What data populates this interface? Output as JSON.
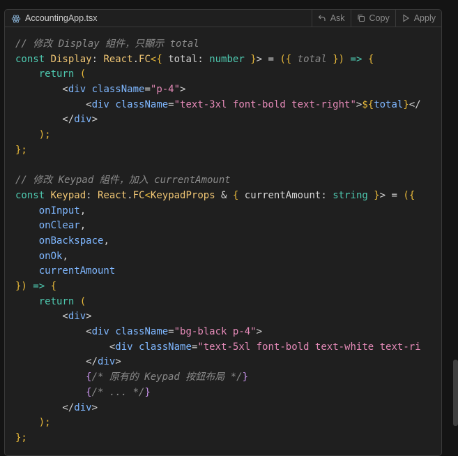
{
  "header": {
    "filename": "AccountingApp.tsx",
    "file_icon": "react-icon",
    "actions": [
      {
        "label": "Ask",
        "icon": "reply-icon"
      },
      {
        "label": "Copy",
        "icon": "copy-icon"
      },
      {
        "label": "Apply",
        "icon": "play-icon"
      }
    ]
  },
  "code_lines": [
    [
      {
        "t": "// 修改 Display 組件，只顯示 total",
        "c": "comment"
      }
    ],
    [
      {
        "t": "const ",
        "c": "kw"
      },
      {
        "t": "Display",
        "c": "fn"
      },
      {
        "t": ": ",
        "c": ""
      },
      {
        "t": "React",
        "c": "ty"
      },
      {
        "t": ".",
        "c": ""
      },
      {
        "t": "FC",
        "c": "ty"
      },
      {
        "t": "<{",
        "c": "br"
      },
      {
        "t": " total",
        "c": ""
      },
      {
        "t": ": ",
        "c": ""
      },
      {
        "t": "number",
        "c": "kw"
      },
      {
        "t": " }",
        "c": "br"
      },
      {
        "t": "> = ",
        "c": ""
      },
      {
        "t": "({ ",
        "c": "br"
      },
      {
        "t": "total",
        "c": "comment"
      },
      {
        "t": " })",
        "c": "br"
      },
      {
        "t": " => ",
        "c": "kw"
      },
      {
        "t": "{",
        "c": "br"
      }
    ],
    [
      {
        "t": "    return ",
        "c": "kw"
      },
      {
        "t": "(",
        "c": "br"
      }
    ],
    [
      {
        "t": "        <",
        "c": ""
      },
      {
        "t": "div",
        "c": "prop"
      },
      {
        "t": " ",
        "c": ""
      },
      {
        "t": "className",
        "c": "prop"
      },
      {
        "t": "=",
        "c": ""
      },
      {
        "t": "\"p-4\"",
        "c": "str"
      },
      {
        "t": ">",
        "c": ""
      }
    ],
    [
      {
        "t": "            <",
        "c": ""
      },
      {
        "t": "div",
        "c": "prop"
      },
      {
        "t": " ",
        "c": ""
      },
      {
        "t": "className",
        "c": "prop"
      },
      {
        "t": "=",
        "c": ""
      },
      {
        "t": "\"text-3xl font-bold text-right\"",
        "c": "str"
      },
      {
        "t": ">",
        "c": ""
      },
      {
        "t": "${",
        "c": "br"
      },
      {
        "t": "total",
        "c": "prop"
      },
      {
        "t": "}",
        "c": "br"
      },
      {
        "t": "</",
        "c": ""
      }
    ],
    [
      {
        "t": "        </",
        "c": ""
      },
      {
        "t": "div",
        "c": "prop"
      },
      {
        "t": ">",
        "c": ""
      }
    ],
    [
      {
        "t": "    );",
        "c": "br"
      }
    ],
    [
      {
        "t": "};",
        "c": "br"
      }
    ],
    [
      {
        "t": "",
        "c": ""
      }
    ],
    [
      {
        "t": "// 修改 Keypad 組件，加入 currentAmount",
        "c": "comment"
      }
    ],
    [
      {
        "t": "const ",
        "c": "kw"
      },
      {
        "t": "Keypad",
        "c": "fn"
      },
      {
        "t": ": ",
        "c": ""
      },
      {
        "t": "React",
        "c": "ty"
      },
      {
        "t": ".",
        "c": ""
      },
      {
        "t": "FC",
        "c": "ty"
      },
      {
        "t": "<",
        "c": "br"
      },
      {
        "t": "KeypadProps",
        "c": "ty"
      },
      {
        "t": " & ",
        "c": ""
      },
      {
        "t": "{",
        "c": "br"
      },
      {
        "t": " currentAmount",
        "c": ""
      },
      {
        "t": ": ",
        "c": ""
      },
      {
        "t": "string",
        "c": "kw"
      },
      {
        "t": " }",
        "c": "br"
      },
      {
        "t": "> = ",
        "c": ""
      },
      {
        "t": "({",
        "c": "br"
      }
    ],
    [
      {
        "t": "    onInput",
        "c": "prop"
      },
      {
        "t": ",",
        "c": ""
      }
    ],
    [
      {
        "t": "    onClear",
        "c": "prop"
      },
      {
        "t": ",",
        "c": ""
      }
    ],
    [
      {
        "t": "    onBackspace",
        "c": "prop"
      },
      {
        "t": ",",
        "c": ""
      }
    ],
    [
      {
        "t": "    onOk",
        "c": "prop"
      },
      {
        "t": ",",
        "c": ""
      }
    ],
    [
      {
        "t": "    currentAmount",
        "c": "prop"
      }
    ],
    [
      {
        "t": "})",
        "c": "br"
      },
      {
        "t": " => ",
        "c": "kw"
      },
      {
        "t": "{",
        "c": "br"
      }
    ],
    [
      {
        "t": "    return ",
        "c": "kw"
      },
      {
        "t": "(",
        "c": "br"
      }
    ],
    [
      {
        "t": "        <",
        "c": ""
      },
      {
        "t": "div",
        "c": "prop"
      },
      {
        "t": ">",
        "c": ""
      }
    ],
    [
      {
        "t": "            <",
        "c": ""
      },
      {
        "t": "div",
        "c": "prop"
      },
      {
        "t": " ",
        "c": ""
      },
      {
        "t": "className",
        "c": "prop"
      },
      {
        "t": "=",
        "c": ""
      },
      {
        "t": "\"bg-black p-4\"",
        "c": "str"
      },
      {
        "t": ">",
        "c": ""
      }
    ],
    [
      {
        "t": "                <",
        "c": ""
      },
      {
        "t": "div",
        "c": "prop"
      },
      {
        "t": " ",
        "c": ""
      },
      {
        "t": "className",
        "c": "prop"
      },
      {
        "t": "=",
        "c": ""
      },
      {
        "t": "\"text-5xl font-bold text-white text-ri",
        "c": "str"
      }
    ],
    [
      {
        "t": "            </",
        "c": ""
      },
      {
        "t": "div",
        "c": "prop"
      },
      {
        "t": ">",
        "c": ""
      }
    ],
    [
      {
        "t": "            {",
        "c": "tpl"
      },
      {
        "t": "/* 原有的 Keypad 按鈕布局 */",
        "c": "comment"
      },
      {
        "t": "}",
        "c": "tpl"
      }
    ],
    [
      {
        "t": "            {",
        "c": "tpl"
      },
      {
        "t": "/* ... */",
        "c": "comment"
      },
      {
        "t": "}",
        "c": "tpl"
      }
    ],
    [
      {
        "t": "        </",
        "c": ""
      },
      {
        "t": "div",
        "c": "prop"
      },
      {
        "t": ">",
        "c": ""
      }
    ],
    [
      {
        "t": "    );",
        "c": "br"
      }
    ],
    [
      {
        "t": "};",
        "c": "br"
      }
    ]
  ]
}
